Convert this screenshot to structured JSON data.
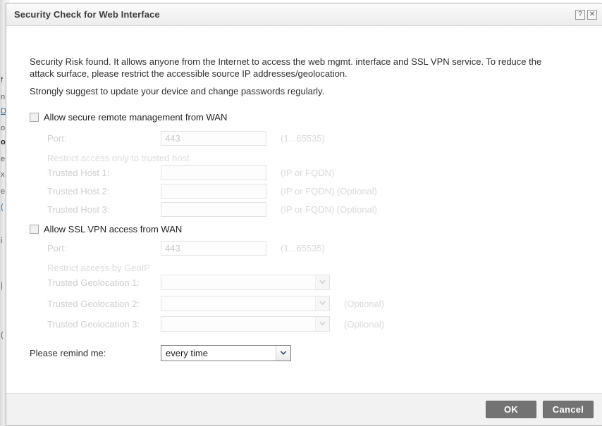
{
  "background_page": {
    "fragments": [
      "f",
      "n",
      "D",
      "o",
      "o",
      "e",
      "x",
      "e",
      "(",
      "i",
      "|",
      "("
    ]
  },
  "dialog": {
    "title": "Security Check for Web Interface",
    "title_buttons": [
      {
        "name": "help-button",
        "glyph": "?"
      },
      {
        "name": "close-button",
        "glyph": "✕"
      }
    ],
    "intro_paragraph_1": "Security Risk found. It allows anyone from the Internet to access the web mgmt. interface and SSL VPN service. To reduce the attack surface, please restrict the accessible source IP addresses/geolocation.",
    "intro_paragraph_2": "Strongly suggest to update your device and change passwords regularly.",
    "sections": {
      "wan_mgmt": {
        "checkbox_label": "Allow secure remote management from WAN",
        "checked": false,
        "port_label": "Port:",
        "port_value": "443",
        "port_hint": "(1...65535)",
        "subheading": "Restrict access only to trusted host",
        "hosts": [
          {
            "label": "Trusted Host 1:",
            "value": "",
            "hint": "(IP or FQDN)"
          },
          {
            "label": "Trusted Host 2:",
            "value": "",
            "hint": "(IP or FQDN) (Optional)"
          },
          {
            "label": "Trusted Host 3:",
            "value": "",
            "hint": "(IP or FQDN) (Optional)"
          }
        ]
      },
      "ssl_vpn": {
        "checkbox_label": "Allow SSL VPN access from WAN",
        "checked": false,
        "port_label": "Port:",
        "port_value": "443",
        "port_hint": "(1...65535)",
        "subheading": "Restrict access by GeoIP",
        "geolocations": [
          {
            "label": "Trusted Geolocation 1:",
            "value": "",
            "hint": ""
          },
          {
            "label": "Trusted Geolocation 2:",
            "value": "",
            "hint": "(Optional)"
          },
          {
            "label": "Trusted Geolocation 3:",
            "value": "",
            "hint": "(Optional)"
          }
        ]
      }
    },
    "remind": {
      "label": "Please remind me:",
      "selected": "every time"
    },
    "footer": {
      "ok_label": "OK",
      "cancel_label": "Cancel"
    }
  },
  "colors": {
    "titlebar": "#f2f2f2",
    "button_grey": "#737373",
    "disabled_text": "#cfcfcf",
    "body_text": "#2f2f2f"
  }
}
